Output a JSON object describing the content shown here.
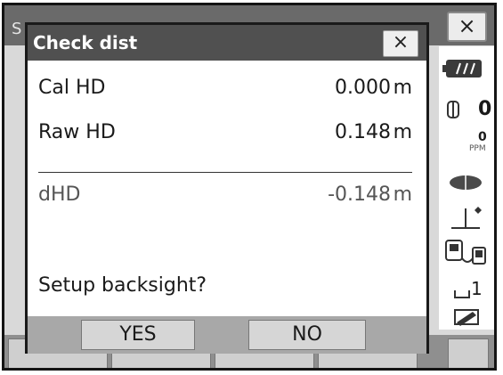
{
  "outer": {
    "title_fragment": "S",
    "close_glyph": "×"
  },
  "sidebar": {
    "battery_icon": "battery-icon",
    "prism_constant": "0",
    "ppm_value": "0",
    "ppm_label": "PPM",
    "target_icon": "target-icon",
    "tilt_icon": "tilt-icon",
    "bluetooth_icon": "communication-icon",
    "mode_value": "1",
    "memory_icon": "memory-icon"
  },
  "dialog": {
    "title": "Check dist",
    "close_glyph": "×",
    "rows": [
      {
        "label": "Cal HD",
        "value": "0.000",
        "unit": "m"
      },
      {
        "label": "Raw HD",
        "value": "0.148",
        "unit": "m"
      }
    ],
    "diff": {
      "label": "dHD",
      "value": "-0.148",
      "unit": "m"
    },
    "prompt": "Setup backsight?",
    "buttons": {
      "yes": "YES",
      "no": "NO"
    }
  }
}
